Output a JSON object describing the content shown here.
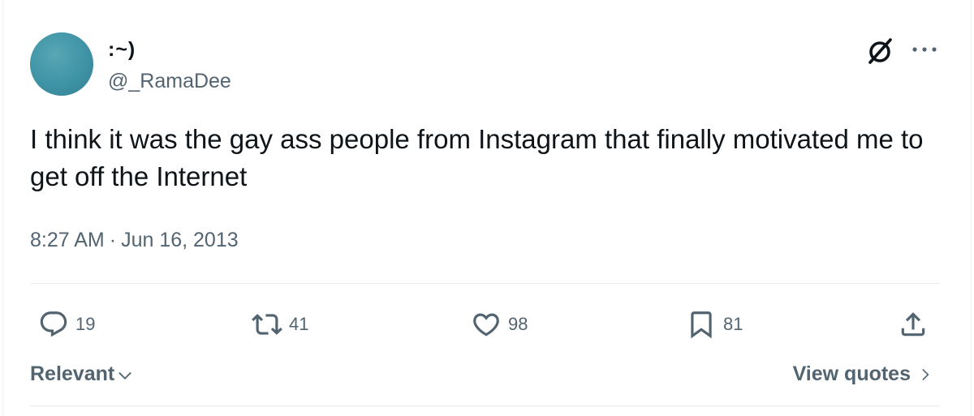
{
  "author": {
    "display_name": ":~)",
    "handle": "@_RamaDee",
    "avatar_color": "#3e93a5"
  },
  "tweet": {
    "text": "I think it was the gay ass people from Instagram that finally motivated me to get off the Internet",
    "time": "8:27 AM",
    "separator": "·",
    "date": "Jun 16, 2013"
  },
  "stats": {
    "replies": "19",
    "retweets": "41",
    "likes": "98",
    "bookmarks": "81"
  },
  "icons": {
    "top_right": [
      "grok-icon",
      "more-icon"
    ],
    "actions": [
      "reply-icon",
      "retweet-icon",
      "like-icon",
      "bookmark-icon",
      "share-icon"
    ]
  },
  "footer": {
    "sort_label": "Relevant",
    "view_quotes_label": "View quotes"
  },
  "colors": {
    "text_primary": "#0f1419",
    "text_secondary": "#536471",
    "divider": "#e7ebee"
  }
}
